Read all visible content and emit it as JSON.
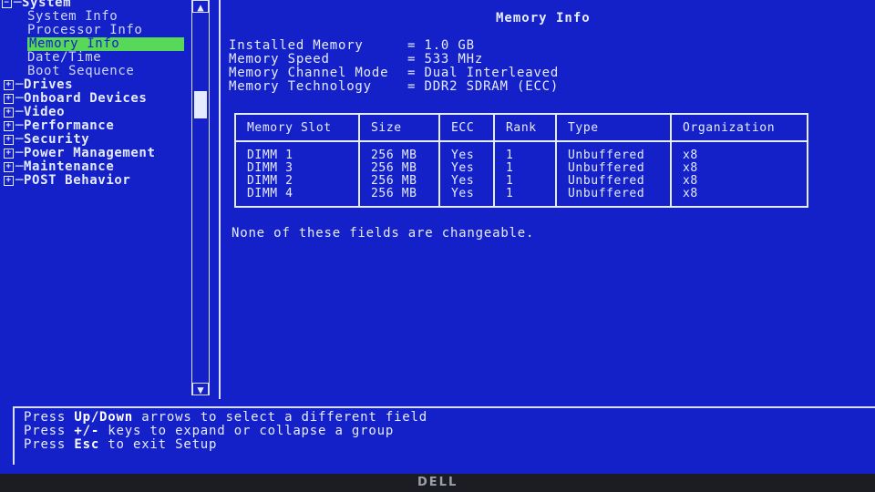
{
  "tree": {
    "items": [
      {
        "label": "System",
        "expander": "-",
        "top": false
      },
      {
        "label": "System Info",
        "child": true
      },
      {
        "label": "Processor Info",
        "child": true
      },
      {
        "label": "Memory Info",
        "child": true,
        "selected": true
      },
      {
        "label": "Date/Time",
        "child": true
      },
      {
        "label": "Boot Sequence",
        "child": true
      },
      {
        "label": "Drives",
        "expander": "+"
      },
      {
        "label": "Onboard Devices",
        "expander": "+"
      },
      {
        "label": "Video",
        "expander": "+"
      },
      {
        "label": "Performance",
        "expander": "+"
      },
      {
        "label": "Security",
        "expander": "+"
      },
      {
        "label": "Power Management",
        "expander": "+"
      },
      {
        "label": "Maintenance",
        "expander": "+"
      },
      {
        "label": "POST Behavior",
        "expander": "+"
      }
    ]
  },
  "detail": {
    "title": "Memory Info",
    "properties": [
      {
        "label": "Installed Memory",
        "value": "1.0 GB"
      },
      {
        "label": "Memory Speed",
        "value": "533 MHz"
      },
      {
        "label": "Memory Channel Mode",
        "value": "Dual Interleaved"
      },
      {
        "label": "Memory Technology",
        "value": "DDR2 SDRAM (ECC)"
      }
    ],
    "table": {
      "headers": [
        "Memory Slot",
        "Size",
        "ECC",
        "Rank",
        "Type",
        "Organization"
      ],
      "rows": [
        [
          "DIMM 1",
          "256 MB",
          "Yes",
          "1",
          "Unbuffered",
          "x8"
        ],
        [
          "DIMM 3",
          "256 MB",
          "Yes",
          "1",
          "Unbuffered",
          "x8"
        ],
        [
          "DIMM 2",
          "256 MB",
          "Yes",
          "1",
          "Unbuffered",
          "x8"
        ],
        [
          "DIMM 4",
          "256 MB",
          "Yes",
          "1",
          "Unbuffered",
          "x8"
        ]
      ]
    },
    "note": "None of these fields are changeable."
  },
  "help": {
    "line1": {
      "pre": "Press ",
      "key": "Up/Down",
      "post": " arrows to select a different field"
    },
    "line2": {
      "pre": "Press ",
      "key": "+/-",
      "post": " keys to expand or collapse a group"
    },
    "line3": {
      "pre": "Press ",
      "key": "Esc",
      "post": " to exit Setup"
    }
  },
  "bezel": {
    "logo": "DELL"
  },
  "colors": {
    "background": "#1420c8",
    "selected": "#58d858",
    "text": "#e6ecff"
  },
  "icons": {
    "scroll_up": "arrow-up-icon",
    "scroll_down": "arrow-down-icon",
    "collapse": "minus-box-icon",
    "expand": "plus-box-icon"
  }
}
